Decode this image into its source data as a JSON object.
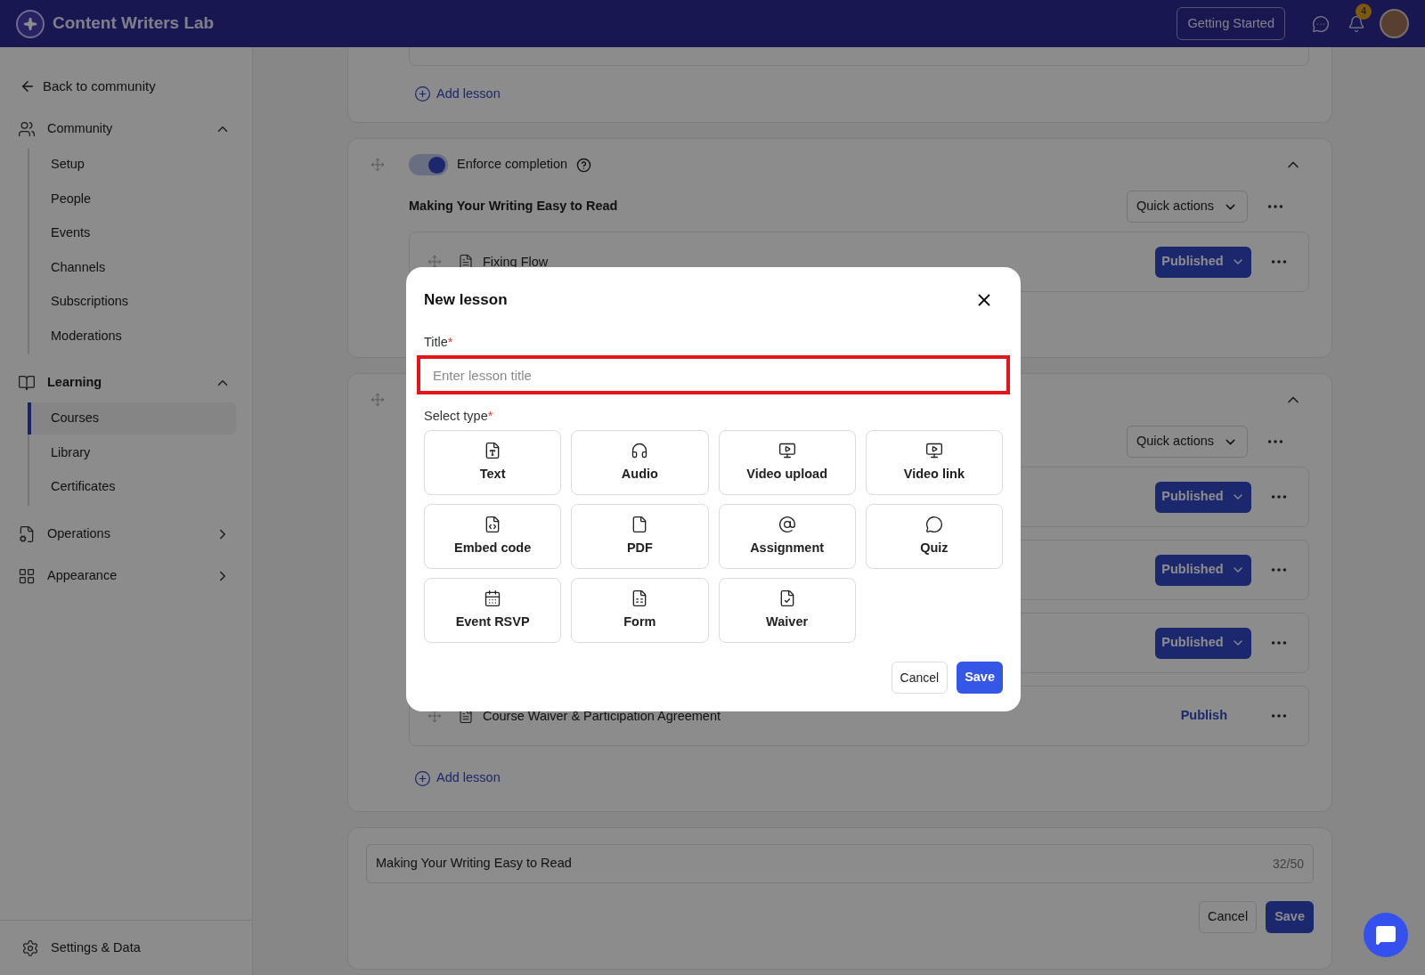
{
  "header": {
    "brand": "Content Writers Lab",
    "getting_started": "Getting Started",
    "notification_count": "4"
  },
  "sidebar": {
    "back": "Back to community",
    "sections": [
      {
        "label": "Community",
        "kind": "community",
        "expanded": true,
        "selected": false,
        "items": [
          {
            "label": "Setup",
            "selected": false
          },
          {
            "label": "People",
            "selected": false
          },
          {
            "label": "Events",
            "selected": false
          },
          {
            "label": "Channels",
            "selected": false
          },
          {
            "label": "Subscriptions",
            "selected": false
          },
          {
            "label": "Moderations",
            "selected": false
          }
        ]
      },
      {
        "label": "Learning",
        "kind": "learning",
        "expanded": true,
        "selected": true,
        "items": [
          {
            "label": "Courses",
            "selected": true
          },
          {
            "label": "Library",
            "selected": false
          },
          {
            "label": "Certificates",
            "selected": false
          }
        ]
      },
      {
        "label": "Operations",
        "kind": "operations",
        "expanded": false,
        "selected": false
      },
      {
        "label": "Appearance",
        "kind": "appearance",
        "expanded": false,
        "selected": false
      }
    ],
    "settings": "Settings & Data"
  },
  "top_card": {
    "add_lesson": "Add lesson"
  },
  "modules": [
    {
      "enforce_completion": {
        "label": "Enforce completion",
        "on": true
      },
      "expanded": true,
      "title": "Making Your Writing Easy to Read",
      "quick_actions": "Quick actions",
      "lessons": [
        {
          "title": "Fixing Flow",
          "status": "Published",
          "kind": "published"
        }
      ]
    },
    {
      "expanded": true,
      "quick_actions": "Quick actions",
      "lessons": [
        {
          "status": "Published",
          "kind": "published"
        },
        {
          "status": "Published",
          "kind": "published"
        },
        {
          "status": "Published",
          "kind": "published"
        },
        {
          "title": "Course Waiver & Participation Agreement",
          "status": "Publish",
          "kind": "draft"
        }
      ],
      "add_lesson": "Add lesson"
    }
  ],
  "title_editor": {
    "value": "Making Your Writing Easy to Read",
    "counter": "32/50",
    "cancel": "Cancel",
    "save": "Save"
  },
  "modal": {
    "title": "New lesson",
    "title_label": "Title",
    "title_required": "*",
    "placeholder": "Enter lesson title",
    "highlighted": true,
    "type_label": "Select type",
    "type_required": "*",
    "types": [
      {
        "label": "Text",
        "kind": "text"
      },
      {
        "label": "Audio",
        "kind": "audio"
      },
      {
        "label": "Video upload",
        "kind": "video_upload"
      },
      {
        "label": "Video link",
        "kind": "video_link"
      },
      {
        "label": "Embed code",
        "kind": "embed"
      },
      {
        "label": "PDF",
        "kind": "pdf"
      },
      {
        "label": "Assignment",
        "kind": "assignment"
      },
      {
        "label": "Quiz",
        "kind": "quiz"
      },
      {
        "label": "Event RSVP",
        "kind": "event"
      },
      {
        "label": "Form",
        "kind": "form"
      },
      {
        "label": "Waiver",
        "kind": "waiver"
      }
    ],
    "cancel": "Cancel",
    "save": "Save"
  }
}
